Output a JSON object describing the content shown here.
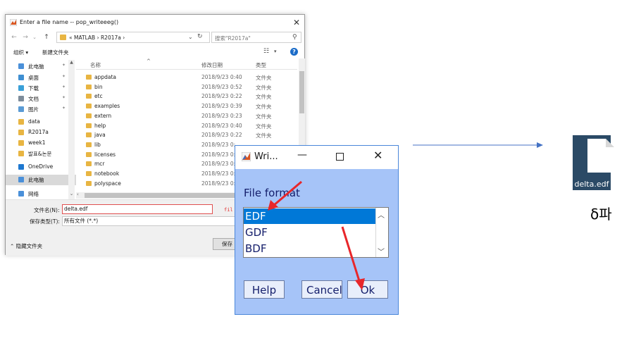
{
  "save_dialog": {
    "title": "Enter a file name -- pop_writeeeg()",
    "close_glyph": "✕",
    "address": "« MATLAB › R2017a ›",
    "search_placeholder": "搜索\"R2017a\"",
    "toolbar": {
      "organize": "组织 ▾",
      "new_folder": "新建文件夹"
    },
    "nav_items": [
      {
        "label": "此电脑",
        "color": "#4a90d9",
        "pinned": true
      },
      {
        "label": "桌面",
        "color": "#3f8fd2",
        "pinned": true
      },
      {
        "label": "下载",
        "color": "#3aa0d8",
        "pinned": true
      },
      {
        "label": "文档",
        "color": "#7d8c9a",
        "pinned": true
      },
      {
        "label": "图片",
        "color": "#5a9bd5",
        "pinned": true
      },
      {
        "label": "data",
        "color": "#e8b542",
        "pinned": false
      },
      {
        "label": "R2017a",
        "color": "#e8b542",
        "pinned": false
      },
      {
        "label": "week1",
        "color": "#e8b542",
        "pinned": false
      },
      {
        "label": "발표&논문",
        "color": "#e8b542",
        "pinned": false
      },
      {
        "label": "OneDrive",
        "color": "#1e78d0",
        "pinned": false
      },
      {
        "label": "此电脑",
        "color": "#4a90d9",
        "pinned": false,
        "selected": true
      },
      {
        "label": "网络",
        "color": "#4a90d9",
        "pinned": false
      }
    ],
    "columns": {
      "name": "名称",
      "date": "修改日期",
      "type": "类型"
    },
    "files": [
      {
        "name": "appdata",
        "date": "2018/9/23 0:40",
        "type": "文件夹"
      },
      {
        "name": "bin",
        "date": "2018/9/23 0:52",
        "type": "文件夹"
      },
      {
        "name": "etc",
        "date": "2018/9/23 0:22",
        "type": "文件夹"
      },
      {
        "name": "examples",
        "date": "2018/9/23 0:39",
        "type": "文件夹"
      },
      {
        "name": "extern",
        "date": "2018/9/23 0:23",
        "type": "文件夹"
      },
      {
        "name": "help",
        "date": "2018/9/23 0:40",
        "type": "文件夹"
      },
      {
        "name": "java",
        "date": "2018/9/23 0:22",
        "type": "文件夹"
      },
      {
        "name": "lib",
        "date": "2018/9/23 0:",
        "type": ""
      },
      {
        "name": "licenses",
        "date": "2018/9/23 0:",
        "type": ""
      },
      {
        "name": "mcr",
        "date": "2018/9/23 0:",
        "type": ""
      },
      {
        "name": "notebook",
        "date": "2018/9/23 0:",
        "type": ""
      },
      {
        "name": "polyspace",
        "date": "2018/9/23 0:",
        "type": ""
      }
    ],
    "filename_label": "文件名(N):",
    "filename_value": "delta.edf",
    "filename_overflow": "fil",
    "type_label": "保存类型(T):",
    "type_value": "所有文件 (*.*)",
    "hide_folders": "⌃ 隐藏文件夹",
    "save_label": "保存"
  },
  "write_dialog": {
    "title": "Wri...",
    "format_label": "File format",
    "formats": [
      "EDF",
      "GDF",
      "BDF"
    ],
    "selected_format": "EDF",
    "buttons": {
      "help": "Help",
      "cancel": "Cancel",
      "ok": "Ok"
    }
  },
  "result": {
    "file_name": "delta.edf",
    "caption": "δ파"
  },
  "colors": {
    "write_dialog_bg": "#a6c4f8",
    "selection": "#0078d7",
    "annotation_red": "#e8262a",
    "arrow_blue": "#4472c4",
    "file_tile_bg": "#2b4a66"
  }
}
